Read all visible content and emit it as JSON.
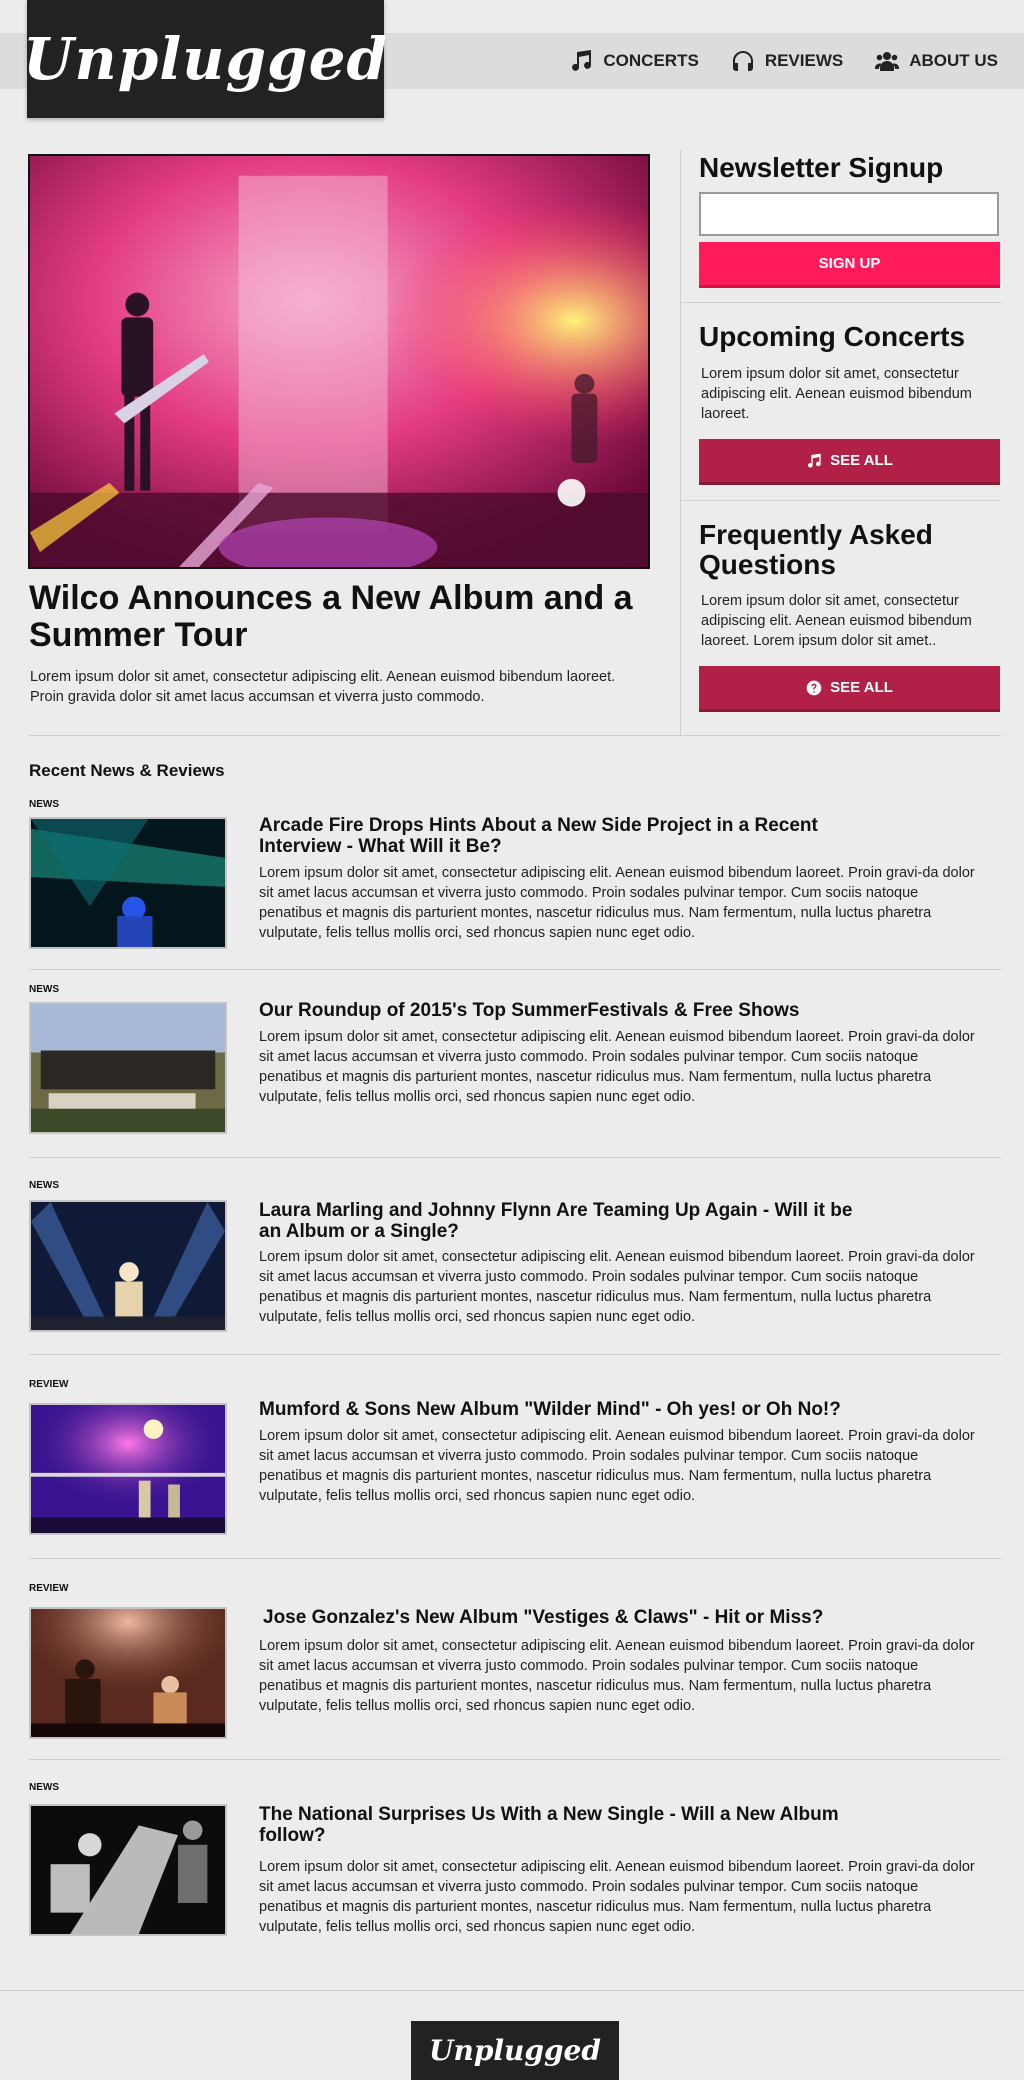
{
  "brand": {
    "name": "Unplugged"
  },
  "nav": [
    {
      "label": "Concerts",
      "icon": "music-note-icon"
    },
    {
      "label": "Reviews",
      "icon": "headphones-icon"
    },
    {
      "label": "About Us",
      "icon": "users-icon"
    }
  ],
  "feature": {
    "title": "Wilco Announces a New Album and a Summer Tour",
    "text": "Lorem ipsum dolor sit amet, consectetur adipiscing elit. Aenean euismod bibendum laoreet. Proin gravida dolor sit amet lacus accumsan et viverra justo commodo."
  },
  "sidebar": {
    "newsletter": {
      "title": "Newsletter Signup",
      "input_value": "",
      "button_label": "Sign Up"
    },
    "concerts": {
      "title": "Upcoming Concerts",
      "text": "Lorem ipsum dolor sit amet, consectetur adipiscing elit. Aenean euismod bibendum laoreet.",
      "button_label": "See All",
      "icon": "music-note-icon"
    },
    "faq": {
      "title": "Frequently Asked Questions",
      "text": "Lorem ipsum dolor sit amet, consectetur adipiscing elit. Aenean euismod bibendum laoreet. Lorem ipsum dolor sit amet..",
      "button_label": "See All",
      "icon": "question-circle-icon"
    }
  },
  "news": {
    "section_title": "Recent News & Reviews",
    "items": [
      {
        "tag": "News",
        "title": "Arcade Fire Drops Hints About a New Side Project in a Recent Interview - What Will it Be?",
        "text": "Lorem ipsum dolor sit amet, consectetur adipiscing elit. Aenean euismod bibendum laoreet. Proin gravi-da dolor sit amet lacus accumsan et viverra justo commodo. Proin sodales pulvinar tempor. Cum sociis natoque penatibus et magnis dis parturient montes, nascetur ridiculus mus. Nam fermentum, nulla luctus pharetra vulputate, felis tellus mollis orci, sed rhoncus sapien nunc eget odio."
      },
      {
        "tag": "News",
        "title": "Our Roundup of 2015's Top SummerFestivals & Free Shows",
        "text": "Lorem ipsum dolor sit amet, consectetur adipiscing elit. Aenean euismod bibendum laoreet. Proin gravi-da dolor sit amet lacus accumsan et viverra justo commodo. Proin sodales pulvinar tempor. Cum sociis natoque penatibus et magnis dis parturient montes, nascetur ridiculus mus. Nam fermentum, nulla luctus pharetra vulputate, felis tellus mollis orci, sed rhoncus sapien nunc eget odio."
      },
      {
        "tag": "News",
        "title": "Laura Marling and Johnny Flynn Are Teaming Up Again - Will it be an Album or a Single?",
        "text": "Lorem ipsum dolor sit amet, consectetur adipiscing elit. Aenean euismod bibendum laoreet. Proin gravi-da dolor sit amet lacus accumsan et viverra justo commodo. Proin sodales pulvinar tempor. Cum sociis natoque penatibus et magnis dis parturient montes, nascetur ridiculus mus. Nam fermentum, nulla luctus pharetra vulputate, felis tellus mollis orci, sed rhoncus sapien nunc eget odio."
      },
      {
        "tag": "Review",
        "title": "Mumford & Sons New Album \"Wilder Mind\" - Oh yes! or Oh No!?",
        "text": "Lorem ipsum dolor sit amet, consectetur adipiscing elit. Aenean euismod bibendum laoreet. Proin gravi-da dolor sit amet lacus accumsan et viverra justo commodo. Proin sodales pulvinar tempor. Cum sociis natoque penatibus et magnis dis parturient montes, nascetur ridiculus mus. Nam fermentum, nulla luctus pharetra vulputate, felis tellus mollis orci, sed rhoncus sapien nunc eget odio."
      },
      {
        "tag": "Review",
        "title": "Jose Gonzalez's New Album  \"Vestiges & Claws\" - Hit or Miss?",
        "text": "Lorem ipsum dolor sit amet, consectetur adipiscing elit. Aenean euismod bibendum laoreet. Proin gravi-da dolor sit amet lacus accumsan et viverra justo commodo. Proin sodales pulvinar tempor. Cum sociis natoque penatibus et magnis dis parturient montes, nascetur ridiculus mus. Nam fermentum, nulla luctus pharetra vulputate, felis tellus mollis orci, sed rhoncus sapien nunc eget odio."
      },
      {
        "tag": "News",
        "title": "The National Surprises Us With a New Single - Will a New Album follow?",
        "text": "Lorem ipsum dolor sit amet, consectetur adipiscing elit. Aenean euismod bibendum laoreet. Proin gravi-da dolor sit amet lacus accumsan et viverra justo commodo. Proin sodales pulvinar tempor. Cum sociis natoque penatibus et magnis dis parturient montes, nascetur ridiculus mus. Nam fermentum, nulla luctus pharetra vulputate, felis tellus mollis orci, sed rhoncus sapien nunc eget odio."
      }
    ]
  },
  "footer": {
    "brand": "Unplugged"
  },
  "colors": {
    "primary_button": "#ff1a5a",
    "secondary_button": "#b12047",
    "logo_bg": "#222222",
    "page_bg": "#ececec",
    "topbar_bg": "#dcdcdc"
  }
}
